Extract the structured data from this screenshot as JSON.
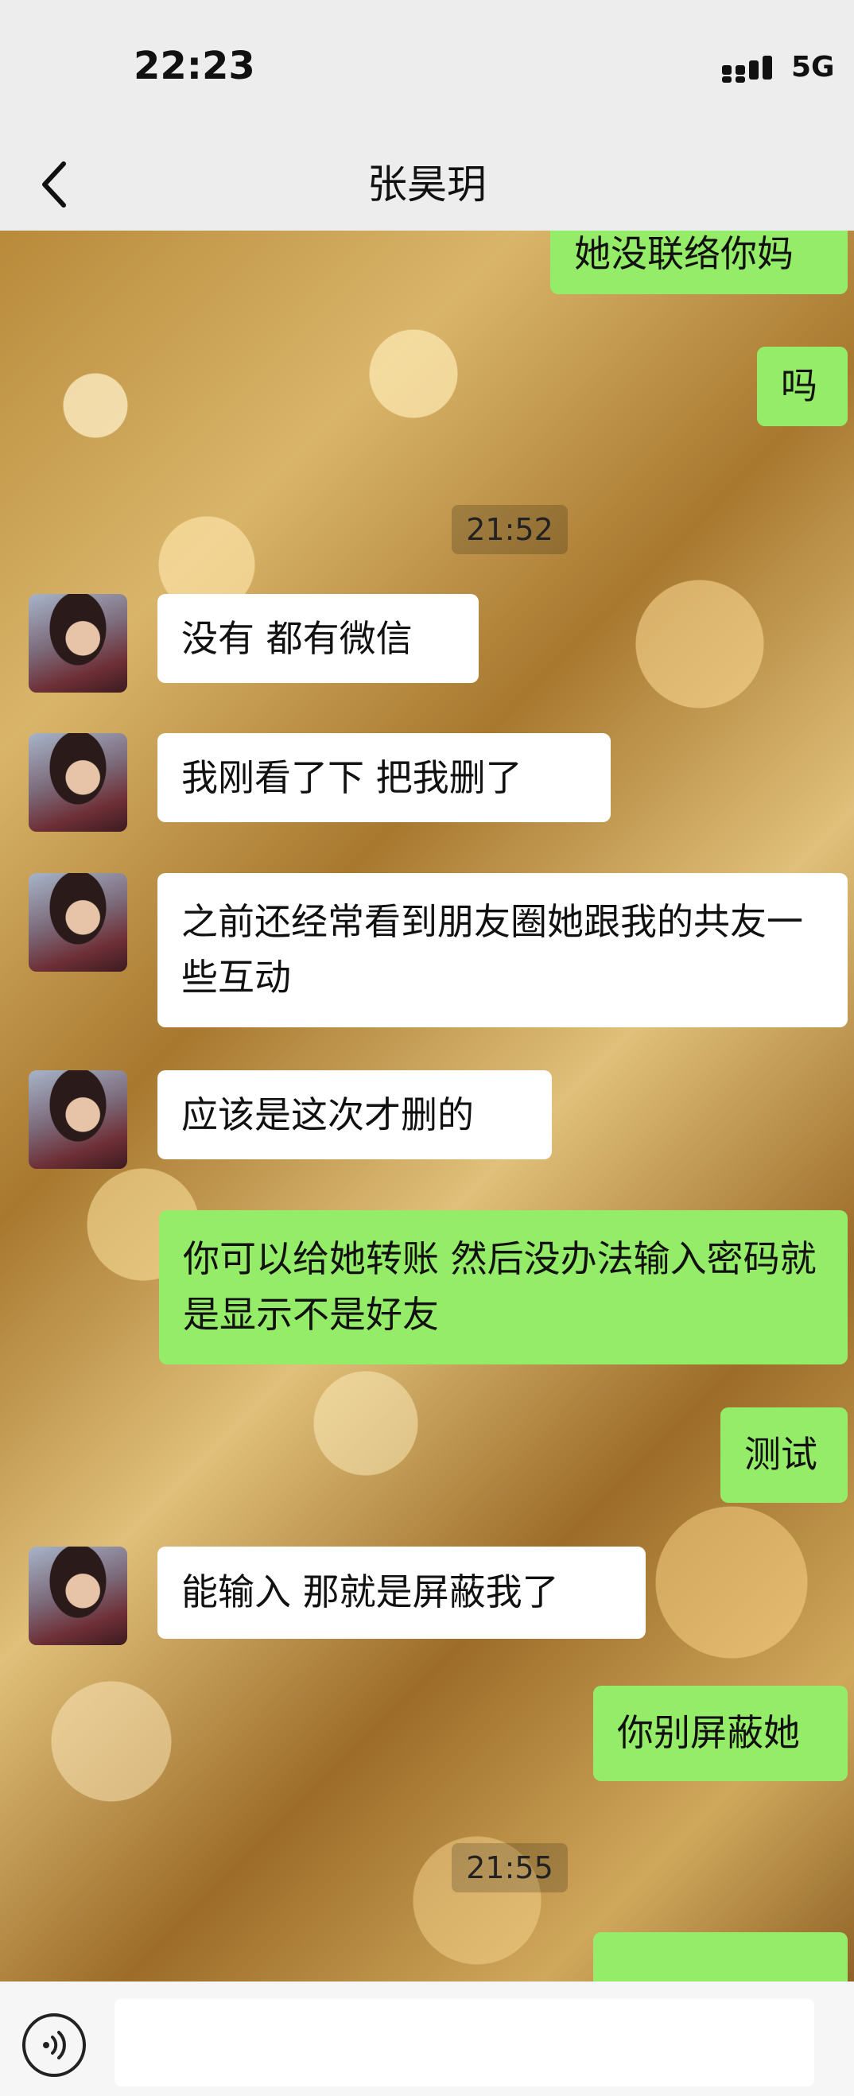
{
  "status_bar": {
    "time": "22:23",
    "network": "5G"
  },
  "header": {
    "title": "张昊玥"
  },
  "messages": [
    {
      "side": "me",
      "text": "她没联络你妈"
    },
    {
      "side": "me",
      "text": "吗"
    },
    {
      "side": "time",
      "text": "21:52"
    },
    {
      "side": "them",
      "text": "没有 都有微信"
    },
    {
      "side": "them",
      "text": "我刚看了下 把我删了"
    },
    {
      "side": "them",
      "text": "之前还经常看到朋友圈她跟我的共友一些互动"
    },
    {
      "side": "them",
      "text": "应该是这次才删的"
    },
    {
      "side": "me",
      "text": "你可以给她转账 然后没办法输入密码就是显示不是好友"
    },
    {
      "side": "me",
      "text": "测试"
    },
    {
      "side": "them",
      "text": "能输入 那就是屏蔽我了"
    },
    {
      "side": "me",
      "text": "你别屏蔽她"
    },
    {
      "side": "time",
      "text": "21:55"
    }
  ],
  "icons": {
    "signal": "signal-icon",
    "back": "back-chevron-icon",
    "voice": "voice-icon"
  },
  "colors": {
    "self_bubble": "#95ec69",
    "other_bubble": "#ffffff"
  }
}
